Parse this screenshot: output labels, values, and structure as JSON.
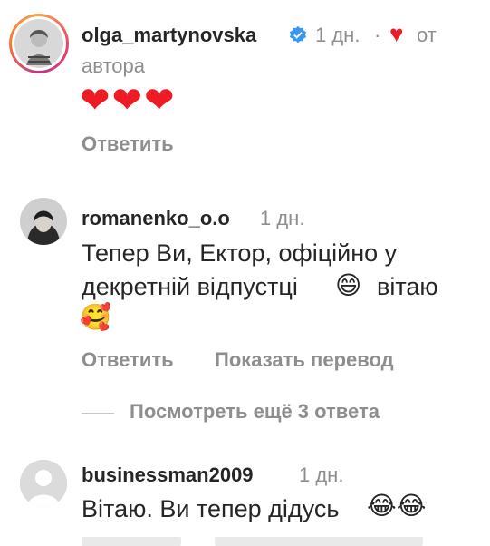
{
  "comment1": {
    "username": "olga_martynovska",
    "time": "1 дн.",
    "dot": "·",
    "heart": "♥",
    "by_author": "от",
    "by_author2": "автора",
    "text": "❤❤❤",
    "reply": "Ответить"
  },
  "comment2": {
    "username": "romanenko_o.o",
    "time": "1 дн.",
    "line1": "Тепер Ви, Ектор, офіційно у",
    "line2a": "декретній відпустці",
    "smile": "😄",
    "line2b": "вітаю",
    "hug": "🥰",
    "reply": "Ответить",
    "translate": "Показать перевод",
    "more_replies": "Посмотреть ещё 3 ответа"
  },
  "comment3": {
    "username": "businessman2009",
    "time": "1 дн.",
    "text": "Вітаю. Ви тепер дідусь",
    "laugh": "😂😂"
  },
  "colors": {
    "text": "#262626",
    "secondary": "#8e8e8e",
    "heart": "#ed1c24",
    "verified": "#3897f0"
  },
  "icons": [
    "verified-badge-icon",
    "heart-icon"
  ]
}
